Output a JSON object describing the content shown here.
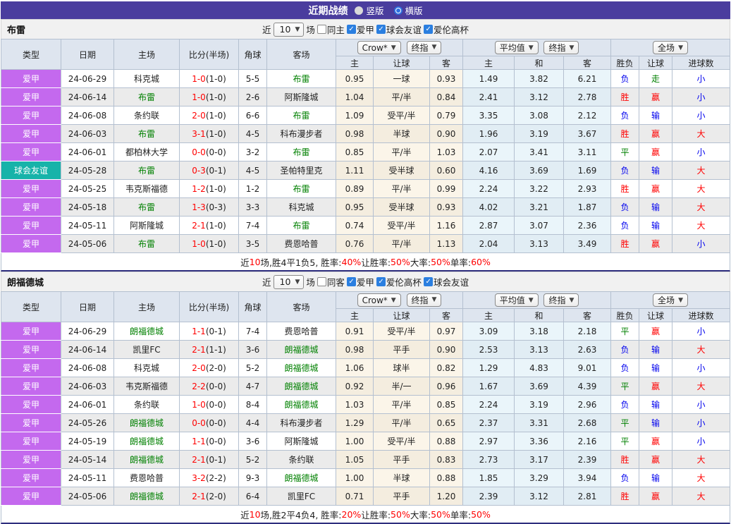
{
  "title_bar": {
    "title": "近期战绩",
    "radios": [
      {
        "label": "竖版",
        "checked": false
      },
      {
        "label": "横版",
        "checked": true
      }
    ]
  },
  "columns": {
    "type": "类型",
    "date": "日期",
    "home": "主场",
    "score": "比分(半场)",
    "corner": "角球",
    "away": "客场",
    "odds_source": "Crow*",
    "final_label": "终指",
    "avg_label": "平均值",
    "final_label2": "终指",
    "full_label": "全场",
    "sub_home": "主",
    "sub_handicap": "让球",
    "sub_away": "客",
    "avg_home": "主",
    "avg_draw": "和",
    "avg_away": "客",
    "res_wdl": "胜负",
    "res_handicap": "让球",
    "res_goals": "进球数"
  },
  "accent_colors": {
    "league_badge": "#c469ee",
    "friendly_badge": "#17b3a9",
    "focus_team": "#008000",
    "win": "#ff0000",
    "lose": "#0000ee",
    "draw": "#008000",
    "title_bar": "#4a3d9e"
  },
  "sections": [
    {
      "team": "布雷",
      "filter": {
        "prefix": "近",
        "count": "10",
        "suffix": "场",
        "same": {
          "label": "同主",
          "checked": false
        },
        "checkboxes": [
          {
            "label": "爱甲",
            "checked": true
          },
          {
            "label": "球会友谊",
            "checked": true
          },
          {
            "label": "爱伦高杯",
            "checked": true
          }
        ]
      },
      "rows": [
        {
          "type": "爱甲",
          "type_color": "purple",
          "date": "24-06-29",
          "home": "科克城",
          "score": "1-0",
          "half": "(1-0)",
          "corner": "5-5",
          "away": "布雷",
          "h_home": "0.95",
          "handicap": "一球",
          "h_away": "0.93",
          "avg_home": "1.49",
          "avg_draw": "3.82",
          "avg_away": "6.21",
          "wdl": "负",
          "h_res": "走",
          "goal_res": "小"
        },
        {
          "type": "爱甲",
          "type_color": "purple",
          "date": "24-06-14",
          "home": "布雷",
          "score": "1-0",
          "half": "(1-0)",
          "corner": "2-6",
          "away": "阿斯隆城",
          "h_home": "1.04",
          "handicap": "平/半",
          "h_away": "0.84",
          "avg_home": "2.41",
          "avg_draw": "3.12",
          "avg_away": "2.78",
          "wdl": "胜",
          "h_res": "赢",
          "goal_res": "小"
        },
        {
          "type": "爱甲",
          "type_color": "purple",
          "date": "24-06-08",
          "home": "条约联",
          "score": "2-0",
          "half": "(1-0)",
          "corner": "6-6",
          "away": "布雷",
          "h_home": "1.09",
          "handicap": "受平/半",
          "h_away": "0.79",
          "avg_home": "3.35",
          "avg_draw": "3.08",
          "avg_away": "2.12",
          "wdl": "负",
          "h_res": "输",
          "goal_res": "小"
        },
        {
          "type": "爱甲",
          "type_color": "purple",
          "date": "24-06-03",
          "home": "布雷",
          "score": "3-1",
          "half": "(1-0)",
          "corner": "4-5",
          "away": "科布漫步者",
          "h_home": "0.98",
          "handicap": "半球",
          "h_away": "0.90",
          "avg_home": "1.96",
          "avg_draw": "3.19",
          "avg_away": "3.67",
          "wdl": "胜",
          "h_res": "赢",
          "goal_res": "大"
        },
        {
          "type": "爱甲",
          "type_color": "purple",
          "date": "24-06-01",
          "home": "都柏林大学",
          "score": "0-0",
          "half": "(0-0)",
          "corner": "3-2",
          "away": "布雷",
          "h_home": "0.85",
          "handicap": "平/半",
          "h_away": "1.03",
          "avg_home": "2.07",
          "avg_draw": "3.41",
          "avg_away": "3.11",
          "wdl": "平",
          "h_res": "赢",
          "goal_res": "小"
        },
        {
          "type": "球会友谊",
          "type_color": "teal",
          "date": "24-05-28",
          "home": "布雷",
          "score": "0-3",
          "half": "(0-1)",
          "corner": "4-5",
          "away": "圣帕特里克",
          "h_home": "1.11",
          "handicap": "受半球",
          "h_away": "0.60",
          "avg_home": "4.16",
          "avg_draw": "3.69",
          "avg_away": "1.69",
          "wdl": "负",
          "h_res": "输",
          "goal_res": "大"
        },
        {
          "type": "爱甲",
          "type_color": "purple",
          "date": "24-05-25",
          "home": "韦克斯福德",
          "score": "1-2",
          "half": "(1-0)",
          "corner": "1-2",
          "away": "布雷",
          "h_home": "0.89",
          "handicap": "平/半",
          "h_away": "0.99",
          "avg_home": "2.24",
          "avg_draw": "3.22",
          "avg_away": "2.93",
          "wdl": "胜",
          "h_res": "赢",
          "goal_res": "大"
        },
        {
          "type": "爱甲",
          "type_color": "purple",
          "date": "24-05-18",
          "home": "布雷",
          "score": "1-3",
          "half": "(0-3)",
          "corner": "3-3",
          "away": "科克城",
          "h_home": "0.95",
          "handicap": "受半球",
          "h_away": "0.93",
          "avg_home": "4.02",
          "avg_draw": "3.21",
          "avg_away": "1.87",
          "wdl": "负",
          "h_res": "输",
          "goal_res": "大"
        },
        {
          "type": "爱甲",
          "type_color": "purple",
          "date": "24-05-11",
          "home": "阿斯隆城",
          "score": "2-1",
          "half": "(1-0)",
          "corner": "7-4",
          "away": "布雷",
          "h_home": "0.74",
          "handicap": "受平/半",
          "h_away": "1.16",
          "avg_home": "2.87",
          "avg_draw": "3.07",
          "avg_away": "2.36",
          "wdl": "负",
          "h_res": "输",
          "goal_res": "大"
        },
        {
          "type": "爱甲",
          "type_color": "purple",
          "date": "24-05-06",
          "home": "布雷",
          "score": "1-0",
          "half": "(1-0)",
          "corner": "3-5",
          "away": "费恩哈普",
          "h_home": "0.76",
          "handicap": "平/半",
          "h_away": "1.13",
          "avg_home": "2.04",
          "avg_draw": "3.13",
          "avg_away": "3.49",
          "wdl": "胜",
          "h_res": "赢",
          "goal_res": "小"
        }
      ],
      "summary": [
        {
          "text": "近",
          "red": false
        },
        {
          "text": "10",
          "red": true
        },
        {
          "text": "场,胜4平1负5, 胜率:",
          "red": false
        },
        {
          "text": "40%",
          "red": true
        },
        {
          "text": " 让胜率:",
          "red": false
        },
        {
          "text": "50%",
          "red": true
        },
        {
          "text": " 大率:",
          "red": false
        },
        {
          "text": "50%",
          "red": true
        },
        {
          "text": " 单率:",
          "red": false
        },
        {
          "text": "60%",
          "red": true
        }
      ]
    },
    {
      "team": "朗福德城",
      "filter": {
        "prefix": "近",
        "count": "10",
        "suffix": "场",
        "same": {
          "label": "同客",
          "checked": false
        },
        "checkboxes": [
          {
            "label": "爱甲",
            "checked": true
          },
          {
            "label": "爱伦高杯",
            "checked": true
          },
          {
            "label": "球会友谊",
            "checked": true
          }
        ]
      },
      "rows": [
        {
          "type": "爱甲",
          "type_color": "purple",
          "date": "24-06-29",
          "home": "朗福德城",
          "score": "1-1",
          "half": "(0-1)",
          "corner": "7-4",
          "away": "费恩哈普",
          "h_home": "0.91",
          "handicap": "受平/半",
          "h_away": "0.97",
          "avg_home": "3.09",
          "avg_draw": "3.18",
          "avg_away": "2.18",
          "wdl": "平",
          "h_res": "赢",
          "goal_res": "小"
        },
        {
          "type": "爱甲",
          "type_color": "purple",
          "date": "24-06-14",
          "home": "凯里FC",
          "score": "2-1",
          "half": "(1-1)",
          "corner": "3-6",
          "away": "朗福德城",
          "h_home": "0.98",
          "handicap": "平手",
          "h_away": "0.90",
          "avg_home": "2.53",
          "avg_draw": "3.13",
          "avg_away": "2.63",
          "wdl": "负",
          "h_res": "输",
          "goal_res": "大"
        },
        {
          "type": "爱甲",
          "type_color": "purple",
          "date": "24-06-08",
          "home": "科克城",
          "score": "2-0",
          "half": "(2-0)",
          "corner": "5-2",
          "away": "朗福德城",
          "h_home": "1.06",
          "handicap": "球半",
          "h_away": "0.82",
          "avg_home": "1.29",
          "avg_draw": "4.83",
          "avg_away": "9.01",
          "wdl": "负",
          "h_res": "输",
          "goal_res": "小"
        },
        {
          "type": "爱甲",
          "type_color": "purple",
          "date": "24-06-03",
          "home": "韦克斯福德",
          "score": "2-2",
          "half": "(0-0)",
          "corner": "4-7",
          "away": "朗福德城",
          "h_home": "0.92",
          "handicap": "半/一",
          "h_away": "0.96",
          "avg_home": "1.67",
          "avg_draw": "3.69",
          "avg_away": "4.39",
          "wdl": "平",
          "h_res": "赢",
          "goal_res": "大"
        },
        {
          "type": "爱甲",
          "type_color": "purple",
          "date": "24-06-01",
          "home": "条约联",
          "score": "1-0",
          "half": "(0-0)",
          "corner": "8-4",
          "away": "朗福德城",
          "h_home": "1.03",
          "handicap": "平/半",
          "h_away": "0.85",
          "avg_home": "2.24",
          "avg_draw": "3.19",
          "avg_away": "2.96",
          "wdl": "负",
          "h_res": "输",
          "goal_res": "小"
        },
        {
          "type": "爱甲",
          "type_color": "purple",
          "date": "24-05-26",
          "home": "朗福德城",
          "score": "0-0",
          "half": "(0-0)",
          "corner": "4-4",
          "away": "科布漫步者",
          "h_home": "1.29",
          "handicap": "平/半",
          "h_away": "0.65",
          "avg_home": "2.37",
          "avg_draw": "3.31",
          "avg_away": "2.68",
          "wdl": "平",
          "h_res": "输",
          "goal_res": "小"
        },
        {
          "type": "爱甲",
          "type_color": "purple",
          "date": "24-05-19",
          "home": "朗福德城",
          "score": "1-1",
          "half": "(0-0)",
          "corner": "3-6",
          "away": "阿斯隆城",
          "h_home": "1.00",
          "handicap": "受平/半",
          "h_away": "0.88",
          "avg_home": "2.97",
          "avg_draw": "3.36",
          "avg_away": "2.16",
          "wdl": "平",
          "h_res": "赢",
          "goal_res": "小"
        },
        {
          "type": "爱甲",
          "type_color": "purple",
          "date": "24-05-14",
          "home": "朗福德城",
          "score": "2-1",
          "half": "(0-1)",
          "corner": "5-2",
          "away": "条约联",
          "h_home": "1.05",
          "handicap": "平手",
          "h_away": "0.83",
          "avg_home": "2.73",
          "avg_draw": "3.17",
          "avg_away": "2.39",
          "wdl": "胜",
          "h_res": "赢",
          "goal_res": "大"
        },
        {
          "type": "爱甲",
          "type_color": "purple",
          "date": "24-05-11",
          "home": "费恩哈普",
          "score": "3-2",
          "half": "(2-2)",
          "corner": "9-3",
          "away": "朗福德城",
          "h_home": "1.00",
          "handicap": "半球",
          "h_away": "0.88",
          "avg_home": "1.85",
          "avg_draw": "3.29",
          "avg_away": "3.94",
          "wdl": "负",
          "h_res": "输",
          "goal_res": "大"
        },
        {
          "type": "爱甲",
          "type_color": "purple",
          "date": "24-05-06",
          "home": "朗福德城",
          "score": "2-1",
          "half": "(2-0)",
          "corner": "6-4",
          "away": "凯里FC",
          "h_home": "0.71",
          "handicap": "平手",
          "h_away": "1.20",
          "avg_home": "2.39",
          "avg_draw": "3.12",
          "avg_away": "2.81",
          "wdl": "胜",
          "h_res": "赢",
          "goal_res": "大"
        }
      ],
      "summary": [
        {
          "text": "近",
          "red": false
        },
        {
          "text": "10",
          "red": true
        },
        {
          "text": "场,胜2平4负4, 胜率:",
          "red": false
        },
        {
          "text": "20%",
          "red": true
        },
        {
          "text": " 让胜率:",
          "red": false
        },
        {
          "text": "50%",
          "red": true
        },
        {
          "text": " 大率:",
          "red": false
        },
        {
          "text": "50%",
          "red": true
        },
        {
          "text": " 单率:",
          "red": false
        },
        {
          "text": "50%",
          "red": true
        }
      ]
    }
  ]
}
